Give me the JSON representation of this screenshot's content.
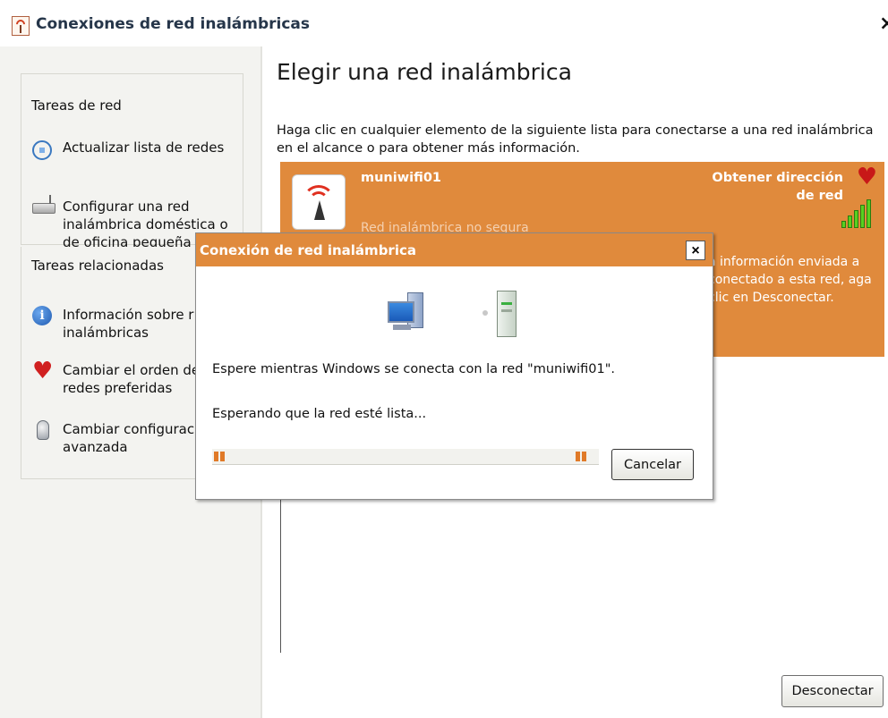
{
  "window": {
    "title": "Conexiones de red inalámbricas",
    "close_glyph": "×"
  },
  "sidebar": {
    "network_tasks": {
      "title": "Tareas de red",
      "items": [
        {
          "label": "Actualizar lista de redes",
          "icon": "refresh-icon"
        },
        {
          "label": "Configurar una red inalámbrica doméstica o de oficina pequeña",
          "icon": "router-icon"
        }
      ]
    },
    "related_tasks": {
      "title": "Tareas relacionadas",
      "items": [
        {
          "label": "Información sobre r",
          "label2": "inalámbricas",
          "icon": "info-icon"
        },
        {
          "label": "Cambiar el orden de",
          "label2": "redes preferidas",
          "icon": "heart-icon"
        },
        {
          "label": "Cambiar configuraci",
          "label2": "avanzada",
          "icon": "bulb-icon"
        }
      ]
    }
  },
  "main": {
    "heading": "Elegir una red inalámbrica",
    "description": "Haga clic en cualquier elemento de la siguiente lista para conectarse a una red inalámbrica en el alcance o para obtener más información.",
    "network": {
      "name": "muniwifi01",
      "status": "Obtener dirección de red",
      "security": "Red inalámbrica no segura",
      "detail": "a información enviada a conectado a esta red, aga clic en Desconectar.",
      "signal_bars": 5,
      "signal_strength": 5,
      "accent_color": "#e08a3c"
    },
    "disconnect_label": "Desconectar"
  },
  "dialog": {
    "title": "Conexión de red inalámbrica",
    "close_glyph": "×",
    "message": "Espere mientras Windows se conecta con la red \"muniwifi01\".",
    "status": "Esperando que la red esté lista...",
    "cancel_label": "Cancelar"
  },
  "colors": {
    "accent": "#e08a3c",
    "title_text": "#26364a",
    "pane_bg": "#f3f3f0"
  }
}
